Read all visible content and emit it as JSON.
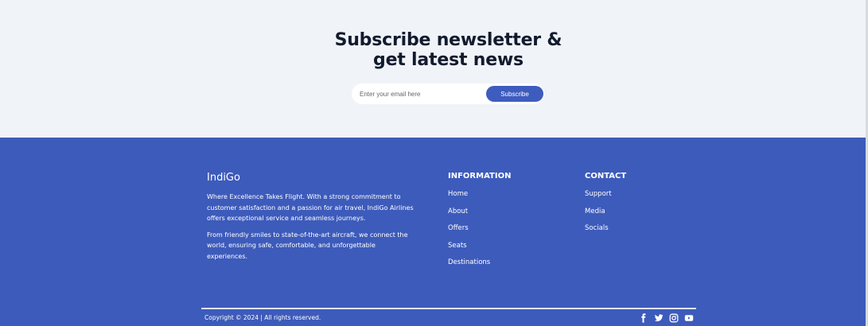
{
  "newsletter": {
    "title_line1": "Subscribe newsletter &",
    "title_line2": "get latest news",
    "email_placeholder": "Enter your email here",
    "email_value": "",
    "button_label": "Subscribe"
  },
  "footer": {
    "brand": "IndiGo",
    "about_p1": "Where Excellence Takes Flight. With a strong commitment to customer satisfaction and a passion for air travel, IndiGo Airlines offers exceptional service and seamless journeys.",
    "about_p2": "From friendly smiles to state-of-the-art aircraft, we connect the world, ensuring safe, comfortable, and unforgettable experiences.",
    "information": {
      "heading": "INFORMATION",
      "links": [
        "Home",
        "About",
        "Offers",
        "Seats",
        "Destinations"
      ]
    },
    "contact": {
      "heading": "CONTACT",
      "links": [
        "Support",
        "Media",
        "Socials"
      ]
    },
    "copyright": "Copyright © 2024 | All rights reserved.",
    "social_icons": [
      "facebook-icon",
      "twitter-icon",
      "instagram-icon",
      "youtube-icon"
    ]
  },
  "colors": {
    "footer_bg": "#3d5bbb",
    "button_bg": "#3e5cbe",
    "newsletter_bg": "#f0f3f8",
    "title_text": "#121b2e"
  }
}
